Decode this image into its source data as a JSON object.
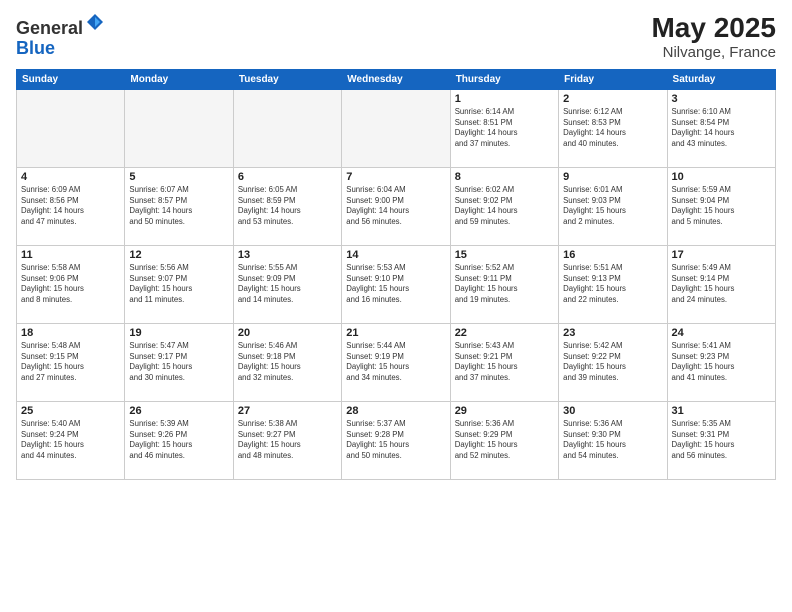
{
  "header": {
    "logo_general": "General",
    "logo_blue": "Blue",
    "month": "May 2025",
    "location": "Nilvange, France"
  },
  "weekdays": [
    "Sunday",
    "Monday",
    "Tuesday",
    "Wednesday",
    "Thursday",
    "Friday",
    "Saturday"
  ],
  "weeks": [
    [
      {
        "day": "",
        "info": ""
      },
      {
        "day": "",
        "info": ""
      },
      {
        "day": "",
        "info": ""
      },
      {
        "day": "",
        "info": ""
      },
      {
        "day": "1",
        "info": "Sunrise: 6:14 AM\nSunset: 8:51 PM\nDaylight: 14 hours\nand 37 minutes."
      },
      {
        "day": "2",
        "info": "Sunrise: 6:12 AM\nSunset: 8:53 PM\nDaylight: 14 hours\nand 40 minutes."
      },
      {
        "day": "3",
        "info": "Sunrise: 6:10 AM\nSunset: 8:54 PM\nDaylight: 14 hours\nand 43 minutes."
      }
    ],
    [
      {
        "day": "4",
        "info": "Sunrise: 6:09 AM\nSunset: 8:56 PM\nDaylight: 14 hours\nand 47 minutes."
      },
      {
        "day": "5",
        "info": "Sunrise: 6:07 AM\nSunset: 8:57 PM\nDaylight: 14 hours\nand 50 minutes."
      },
      {
        "day": "6",
        "info": "Sunrise: 6:05 AM\nSunset: 8:59 PM\nDaylight: 14 hours\nand 53 minutes."
      },
      {
        "day": "7",
        "info": "Sunrise: 6:04 AM\nSunset: 9:00 PM\nDaylight: 14 hours\nand 56 minutes."
      },
      {
        "day": "8",
        "info": "Sunrise: 6:02 AM\nSunset: 9:02 PM\nDaylight: 14 hours\nand 59 minutes."
      },
      {
        "day": "9",
        "info": "Sunrise: 6:01 AM\nSunset: 9:03 PM\nDaylight: 15 hours\nand 2 minutes."
      },
      {
        "day": "10",
        "info": "Sunrise: 5:59 AM\nSunset: 9:04 PM\nDaylight: 15 hours\nand 5 minutes."
      }
    ],
    [
      {
        "day": "11",
        "info": "Sunrise: 5:58 AM\nSunset: 9:06 PM\nDaylight: 15 hours\nand 8 minutes."
      },
      {
        "day": "12",
        "info": "Sunrise: 5:56 AM\nSunset: 9:07 PM\nDaylight: 15 hours\nand 11 minutes."
      },
      {
        "day": "13",
        "info": "Sunrise: 5:55 AM\nSunset: 9:09 PM\nDaylight: 15 hours\nand 14 minutes."
      },
      {
        "day": "14",
        "info": "Sunrise: 5:53 AM\nSunset: 9:10 PM\nDaylight: 15 hours\nand 16 minutes."
      },
      {
        "day": "15",
        "info": "Sunrise: 5:52 AM\nSunset: 9:11 PM\nDaylight: 15 hours\nand 19 minutes."
      },
      {
        "day": "16",
        "info": "Sunrise: 5:51 AM\nSunset: 9:13 PM\nDaylight: 15 hours\nand 22 minutes."
      },
      {
        "day": "17",
        "info": "Sunrise: 5:49 AM\nSunset: 9:14 PM\nDaylight: 15 hours\nand 24 minutes."
      }
    ],
    [
      {
        "day": "18",
        "info": "Sunrise: 5:48 AM\nSunset: 9:15 PM\nDaylight: 15 hours\nand 27 minutes."
      },
      {
        "day": "19",
        "info": "Sunrise: 5:47 AM\nSunset: 9:17 PM\nDaylight: 15 hours\nand 30 minutes."
      },
      {
        "day": "20",
        "info": "Sunrise: 5:46 AM\nSunset: 9:18 PM\nDaylight: 15 hours\nand 32 minutes."
      },
      {
        "day": "21",
        "info": "Sunrise: 5:44 AM\nSunset: 9:19 PM\nDaylight: 15 hours\nand 34 minutes."
      },
      {
        "day": "22",
        "info": "Sunrise: 5:43 AM\nSunset: 9:21 PM\nDaylight: 15 hours\nand 37 minutes."
      },
      {
        "day": "23",
        "info": "Sunrise: 5:42 AM\nSunset: 9:22 PM\nDaylight: 15 hours\nand 39 minutes."
      },
      {
        "day": "24",
        "info": "Sunrise: 5:41 AM\nSunset: 9:23 PM\nDaylight: 15 hours\nand 41 minutes."
      }
    ],
    [
      {
        "day": "25",
        "info": "Sunrise: 5:40 AM\nSunset: 9:24 PM\nDaylight: 15 hours\nand 44 minutes."
      },
      {
        "day": "26",
        "info": "Sunrise: 5:39 AM\nSunset: 9:26 PM\nDaylight: 15 hours\nand 46 minutes."
      },
      {
        "day": "27",
        "info": "Sunrise: 5:38 AM\nSunset: 9:27 PM\nDaylight: 15 hours\nand 48 minutes."
      },
      {
        "day": "28",
        "info": "Sunrise: 5:37 AM\nSunset: 9:28 PM\nDaylight: 15 hours\nand 50 minutes."
      },
      {
        "day": "29",
        "info": "Sunrise: 5:36 AM\nSunset: 9:29 PM\nDaylight: 15 hours\nand 52 minutes."
      },
      {
        "day": "30",
        "info": "Sunrise: 5:36 AM\nSunset: 9:30 PM\nDaylight: 15 hours\nand 54 minutes."
      },
      {
        "day": "31",
        "info": "Sunrise: 5:35 AM\nSunset: 9:31 PM\nDaylight: 15 hours\nand 56 minutes."
      }
    ]
  ]
}
